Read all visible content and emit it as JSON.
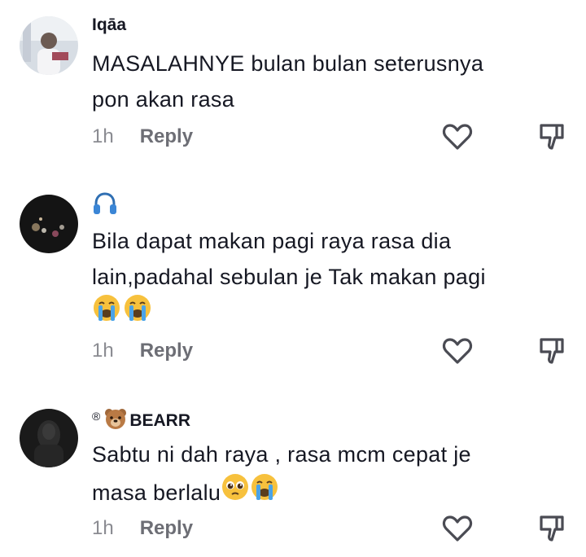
{
  "comments": [
    {
      "username": "Iqāa",
      "text_line1": "MASALAHNYE bulan bulan seterusnya",
      "text_line2": "pon akan rasa",
      "time": "1h",
      "reply": "Reply"
    },
    {
      "username_icon": "headphones-emoji",
      "text_line1": "Bila dapat makan pagi raya rasa dia",
      "text_line2": "lain,padahal sebulan je Tak makan pagi",
      "emoji": "crying-face-emoji x2",
      "time": "1h",
      "reply": "Reply"
    },
    {
      "username_prefix": "®",
      "username": "BEARR",
      "username_icon": "bear-emoji",
      "text_line1": "Sabtu ni dah raya , rasa mcm cepat je",
      "text_line2": "masa berlalu",
      "emoji": "pleading-face-emoji, crying-face-emoji",
      "time": "1h",
      "reply": "Reply"
    }
  ],
  "colors": {
    "text": "#161823",
    "meta": "#8a8b91",
    "reply": "#6d6e75",
    "icon": "#4a4b53"
  }
}
